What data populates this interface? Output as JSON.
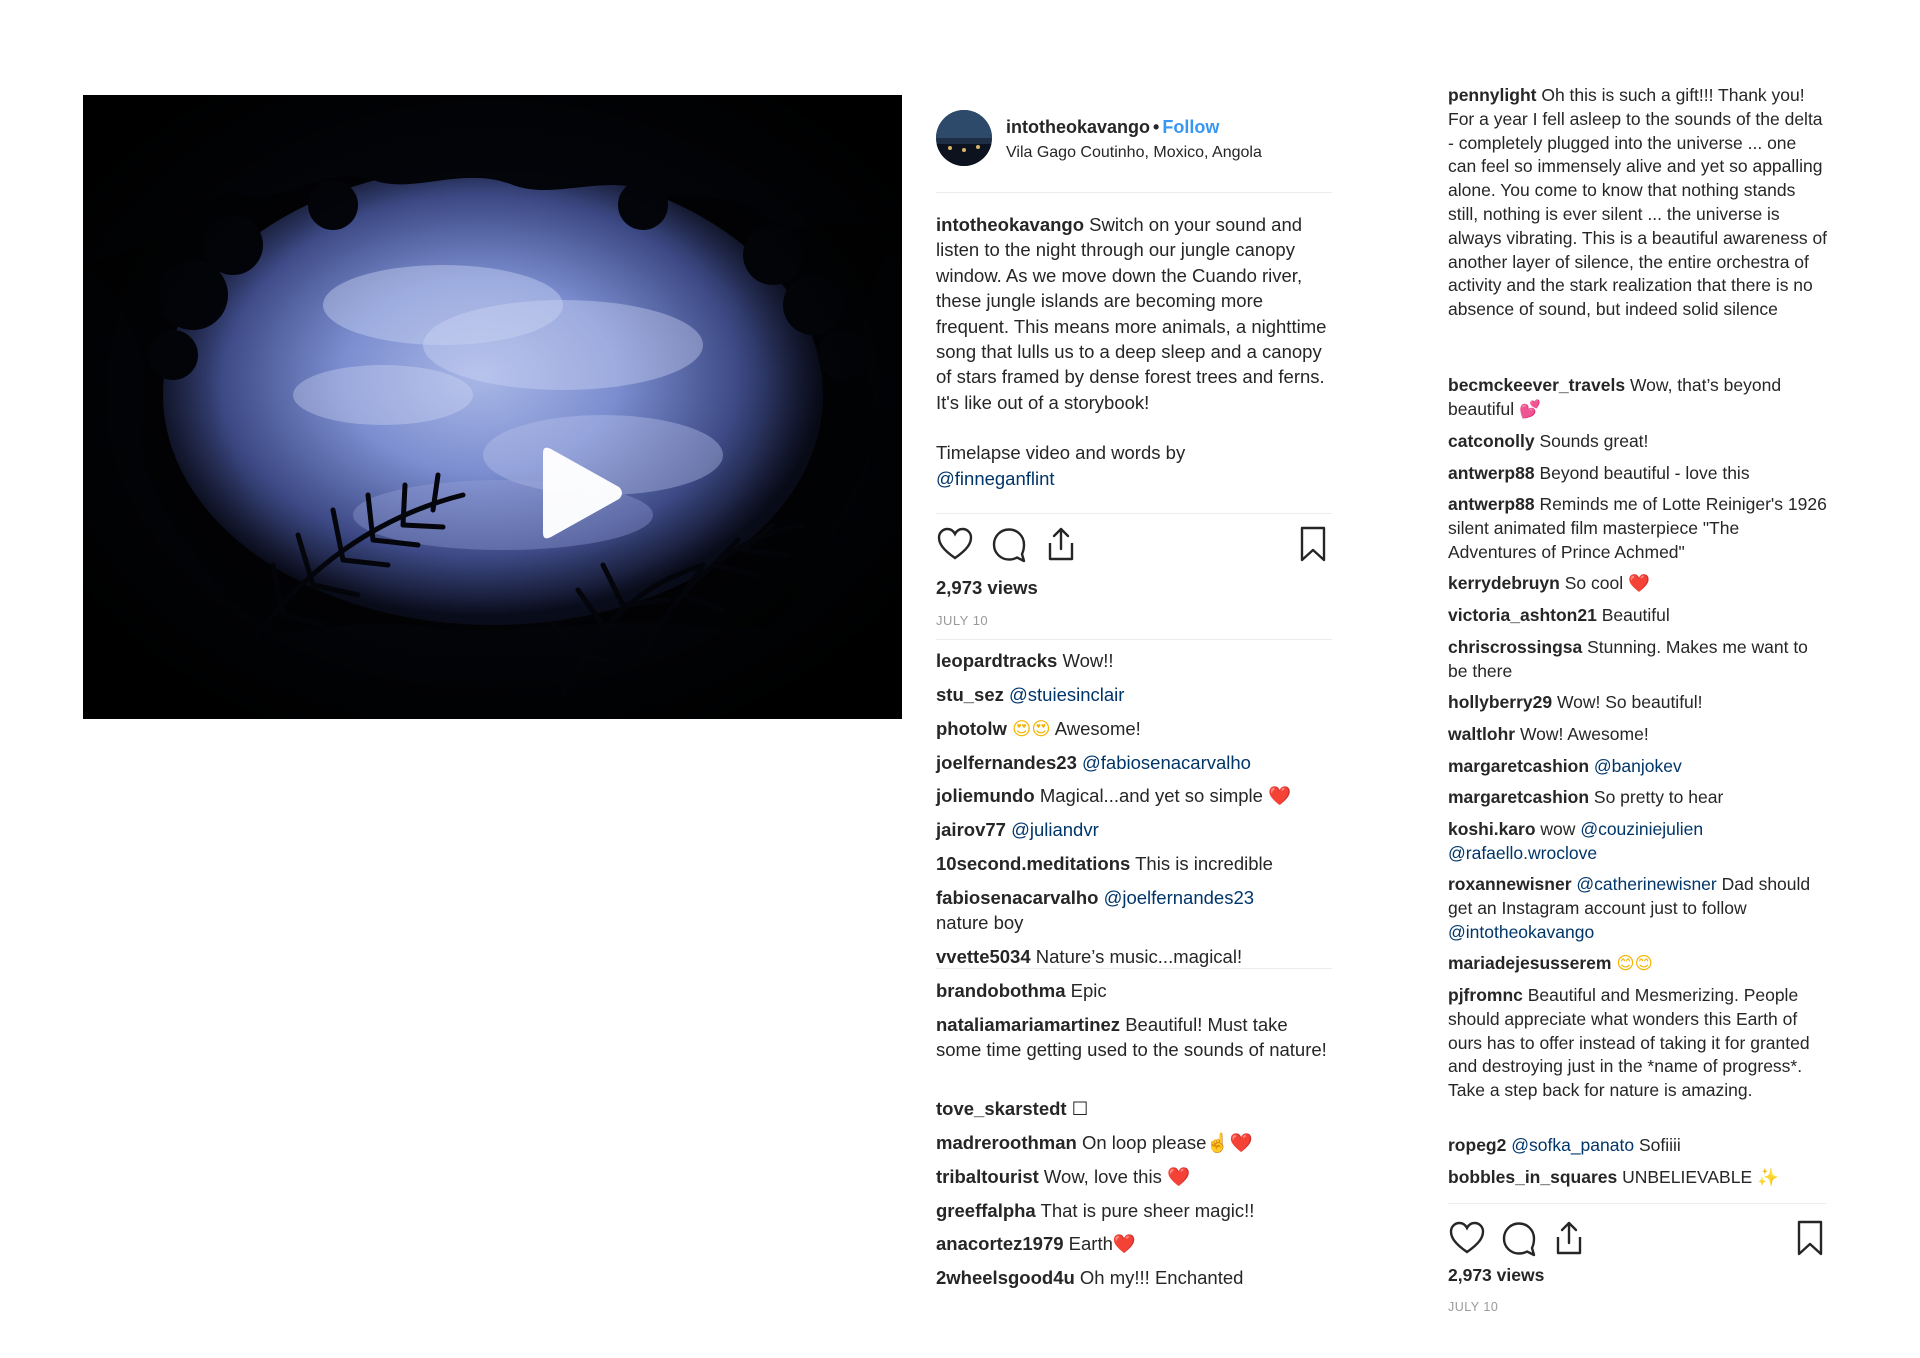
{
  "post": {
    "username": "intotheokavango",
    "follow_label": "Follow",
    "dot": "•",
    "location": "Vila Gago Coutinho, Moxico, Angola",
    "caption_user": "intotheokavango",
    "caption_text": "Switch on your sound and listen to the night through our jungle canopy window. As we move down the Cuando river, these jungle islands are becoming more frequent. This means more animals, a nighttime song that lulls us to a deep sleep and a canopy of stars framed by dense forest trees and ferns. It's like out of a storybook!",
    "credit_text": "Timelapse video and words by",
    "credit_mention": "@finneganflint",
    "views": "2,973 views",
    "date": "JULY 10"
  },
  "icons": {
    "play": "play-icon",
    "avatar": "avatar",
    "like": "heart-icon",
    "comment": "comment-icon",
    "share": "share-icon",
    "save": "bookmark-icon"
  },
  "colors": {
    "follow": "#3897f0",
    "mention": "#003569",
    "date": "#999999"
  },
  "comments_mid": [
    {
      "user": "leopardtracks",
      "text": "Wow!!"
    },
    {
      "user": "stu_sez",
      "mention": "@stuiesinclair"
    },
    {
      "user": "photolw",
      "emoji": "😍😍",
      "text": "Awesome!"
    },
    {
      "user": "joelfernandes23",
      "mention": "@fabiosenacarvalho"
    },
    {
      "user": "joliemundo",
      "text": "Magical...and yet so simple",
      "emoji": "❤️"
    },
    {
      "user": "jairov77",
      "mention": "@juliandvr"
    },
    {
      "user": "10second.meditations",
      "text": "This is incredible"
    },
    {
      "user": "fabiosenacarvalho",
      "mention": "@joelfernandes23",
      "text": "nature boy"
    },
    {
      "user": "vvette5034",
      "text": "Nature’s music...magical!"
    },
    {
      "user": "brandobothma",
      "text": "Epic"
    },
    {
      "user": "nataliamariamartinez",
      "text": "Beautiful! Must take some time getting used to the sounds of nature!"
    },
    {
      "user": "tove_skarstedt",
      "emoji": "☐"
    },
    {
      "user": "madreroothman",
      "text": "On loop please",
      "emoji": "☝️❤️"
    },
    {
      "user": "tribaltourist",
      "text": "Wow, love this",
      "emoji": "❤️"
    },
    {
      "user": "greeffalpha",
      "text": "That is pure sheer magic!!"
    },
    {
      "user": "anacortez1979",
      "text": "Earth",
      "emoji": "❤️"
    },
    {
      "user": "2wheelsgood4u",
      "text": "Oh my!!! Enchanted"
    }
  ],
  "comments_right": [
    {
      "user": "pennylight",
      "text": "Oh this is such a gift!!! Thank you! For a year I fell asleep to the sounds of the delta - completely plugged into the universe ... one can feel so immensely alive and yet so appalling alone. You come to know that nothing stands still, nothing is ever silent ... the universe is always vibrating. This is a beautiful awareness of another layer of silence, the entire orchestra of activity and the stark realization that there is no absence of sound, but indeed solid silence"
    },
    {
      "user": "becmckeever_travels",
      "text": "Wow, that’s beyond beautiful",
      "emoji": "💕"
    },
    {
      "user": "catconolly",
      "text": "Sounds great!"
    },
    {
      "user": "antwerp88",
      "text": "Beyond beautiful - love this"
    },
    {
      "user": "antwerp88",
      "text": "Reminds me of Lotte Reiniger's 1926 silent animated film masterpiece \"The Adventures of Prince Achmed\""
    },
    {
      "user": "kerrydebruyn",
      "text": "So cool",
      "emoji": "❤️"
    },
    {
      "user": "victoria_ashton21",
      "text": "Beautiful"
    },
    {
      "user": "chriscrossingsa",
      "text": "Stunning. Makes me want to be there"
    },
    {
      "user": "hollyberry29",
      "text": "Wow! So beautiful!"
    },
    {
      "user": "waltlohr",
      "text": "Wow! Awesome!"
    },
    {
      "user": "margaretcashion",
      "mention": "@banjokev"
    },
    {
      "user": "margaretcashion",
      "text": "So pretty to hear"
    },
    {
      "user": "koshi.karo",
      "text": "wow",
      "mention": "@couziniejulien",
      "mention2": "@rafaello.wroclove"
    },
    {
      "user": "roxannewisner",
      "mention": "@catherinewisner",
      "text": "Dad should get an Instagram account just to follow",
      "mention2": "@intotheokavango"
    },
    {
      "user": "mariadejesusserem",
      "emoji": "😊😊"
    },
    {
      "user": "pjfromnc",
      "text": "Beautiful and Mesmerizing. People should appreciate what wonders this Earth of ours has to offer instead of taking it for granted and destroying just in the *name of progress*. Take a step back for nature is amazing."
    },
    {
      "user": "ropeg2",
      "mention": "@sofka_panato",
      "text": "Sofiiii"
    },
    {
      "user": "bobbles_in_squares",
      "text": "UNBELIEVABLE",
      "emoji": "✨"
    }
  ]
}
